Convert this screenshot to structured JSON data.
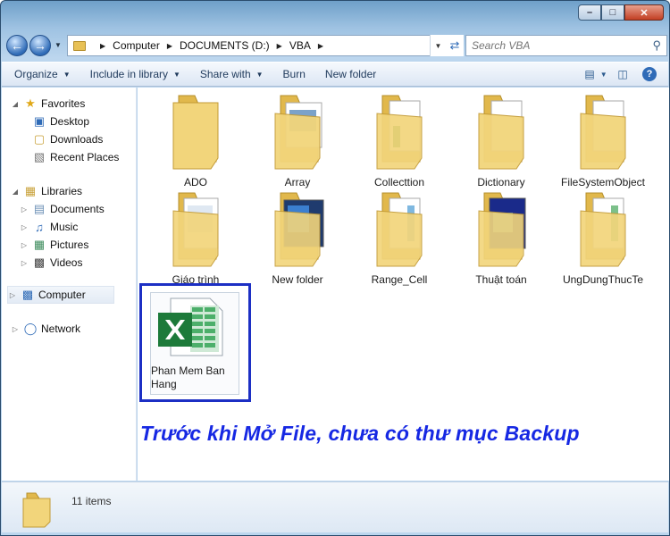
{
  "titlebar": {
    "minimize_label": "–",
    "maximize_label": "□",
    "close_label": "✕"
  },
  "address": {
    "crumbs": [
      "Computer",
      "DOCUMENTS (D:)",
      "VBA"
    ]
  },
  "search": {
    "placeholder": "Search VBA"
  },
  "toolbar": {
    "organize": "Organize",
    "include_in_library": "Include in library",
    "share_with": "Share with",
    "burn": "Burn",
    "new_folder": "New folder"
  },
  "sidebar": {
    "favorites": {
      "label": "Favorites",
      "items": [
        "Desktop",
        "Downloads",
        "Recent Places"
      ]
    },
    "libraries": {
      "label": "Libraries",
      "items": [
        "Documents",
        "Music",
        "Pictures",
        "Videos"
      ]
    },
    "computer": "Computer",
    "network": "Network"
  },
  "folders": [
    {
      "name": "ADO",
      "preview": "empty"
    },
    {
      "name": "Array",
      "preview": "docs"
    },
    {
      "name": "Collecttion",
      "preview": "docs"
    },
    {
      "name": "Dictionary",
      "preview": "docs"
    },
    {
      "name": "FileSystemObject",
      "preview": "docs"
    },
    {
      "name": "Giáo trình",
      "preview": "docs"
    },
    {
      "name": "New folder",
      "preview": "media"
    },
    {
      "name": "Range_Cell",
      "preview": "docs"
    },
    {
      "name": "Thuật toán",
      "preview": "media"
    },
    {
      "name": "UngDungThucTe",
      "preview": "docs"
    }
  ],
  "file": {
    "name_line1": "Phan Mem Ban",
    "name_line2": "Hang",
    "type_icon": "excel-file-icon"
  },
  "annotation": "Trước khi Mở File, chưa có thư mục Backup",
  "status": {
    "count": "11 items"
  },
  "colors": {
    "annotation_text": "#1628e3",
    "selection_border": "#1c2fc4",
    "folder": "#e9c760",
    "excel_green": "#1d7a3a"
  }
}
